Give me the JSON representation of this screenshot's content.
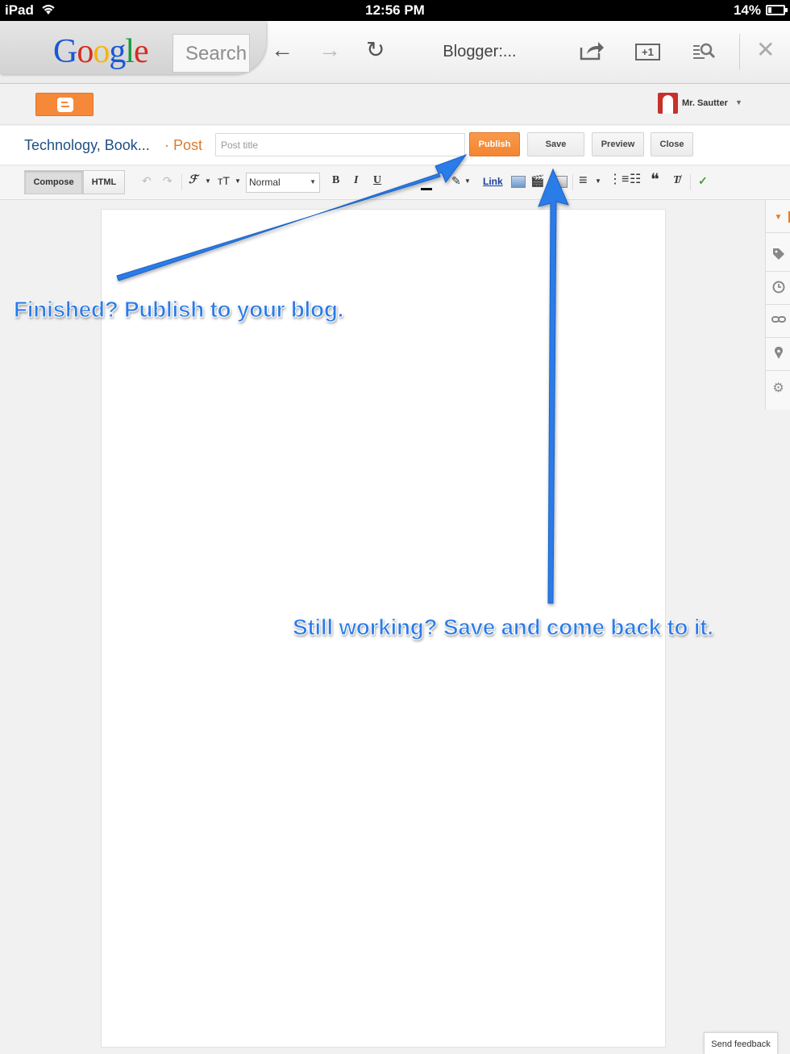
{
  "status_bar": {
    "carrier": "iPad",
    "time": "12:56 PM",
    "battery": "14%"
  },
  "browser": {
    "logo_letters": [
      "G",
      "o",
      "o",
      "g",
      "l",
      "e"
    ],
    "search_text": "Search",
    "page_title": "Blogger:...",
    "icons": {
      "back": "←",
      "forward": "→",
      "reload": "↻",
      "share": "↗",
      "plus_one": "+1",
      "find": "🔍",
      "close": "✕"
    }
  },
  "blogger": {
    "user_name": "Mr. Sautter",
    "blog_name": "Technology, Book...",
    "post_label": "· Post",
    "title_placeholder": "Post title",
    "buttons": {
      "publish": "Publish",
      "save": "Save",
      "preview": "Preview",
      "close": "Close"
    },
    "toolbar": {
      "compose": "Compose",
      "html": "HTML",
      "undo": "↶",
      "redo": "↷",
      "font_family": "ℱ",
      "font_size": "тT",
      "format_value": "Normal",
      "bold": "B",
      "italic": "I",
      "underline": "U",
      "link": "Link",
      "video": "🎬",
      "align": "≡",
      "numbered_list": "⋮≡",
      "bullet_list": "☷",
      "quote": "❝",
      "clear_format": "T̸",
      "spellcheck": "✓"
    },
    "feedback": "Send feedback"
  },
  "annotations": {
    "publish_tip": "Finished?  Publish to your blog.",
    "save_tip": "Still working?  Save and come back to it."
  },
  "colors": {
    "publish_orange": "#f28532",
    "annotation_blue": "#2a7be8",
    "blog_blue": "#1f4f82",
    "post_orange": "#dd7a2b"
  }
}
